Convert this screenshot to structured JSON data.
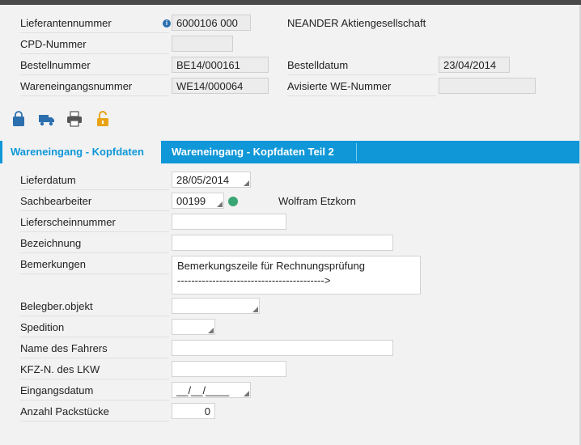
{
  "header": {
    "supplier_number": {
      "label": "Lieferantennummer",
      "value": "6000106 000",
      "name": "NEANDER Aktiengesellschaft"
    },
    "cpd_number": {
      "label": "CPD-Nummer",
      "value": ""
    },
    "order_number": {
      "label": "Bestellnummer",
      "value": "BE14/000161"
    },
    "order_date": {
      "label": "Bestelldatum",
      "value": "23/04/2014"
    },
    "goods_receipt_number": {
      "label": "Wareneingangsnummer",
      "value": "WE14/000064"
    },
    "notified_receipt_number": {
      "label": "Avisierte WE-Nummer",
      "value": ""
    }
  },
  "toolbar": {
    "icons": [
      "shopping-bag-icon",
      "delivery-truck-icon",
      "printer-icon",
      "unlock-icon"
    ],
    "colors": {
      "bag": "#2c6fae",
      "truck": "#2c6fae",
      "printer": "#555555",
      "lock": "#e8a317"
    }
  },
  "tabs": [
    {
      "label": "Wareneingang - Kopfdaten",
      "active": true
    },
    {
      "label": "Wareneingang - Kopfdaten Teil 2",
      "active": false
    }
  ],
  "form": {
    "delivery_date": {
      "label": "Lieferdatum",
      "value": "28/05/2014"
    },
    "clerk": {
      "label": "Sachbearbeiter",
      "value": "00199",
      "name": "Wolfram Etzkorn",
      "status_color": "#3aa675"
    },
    "delivery_note_number": {
      "label": "Lieferscheinnummer",
      "value": ""
    },
    "description": {
      "label": "Bezeichnung",
      "value": ""
    },
    "remarks": {
      "label": "Bemerkungen",
      "value": "Bemerkungszeile für Rechnungsprüfung\n------------------------------------------>"
    },
    "document_object": {
      "label": "Belegber.objekt",
      "value": ""
    },
    "forwarding": {
      "label": "Spedition",
      "value": ""
    },
    "driver_name": {
      "label": "Name des Fahrers",
      "value": ""
    },
    "truck_plate": {
      "label": "KFZ-N. des LKW",
      "value": ""
    },
    "receipt_date": {
      "label": "Eingangsdatum",
      "value": "__/__/____"
    },
    "package_count": {
      "label": "Anzahl Packstücke",
      "value": "0"
    }
  },
  "colors": {
    "accent": "#0f97d8",
    "background": "#f2f2f2"
  }
}
